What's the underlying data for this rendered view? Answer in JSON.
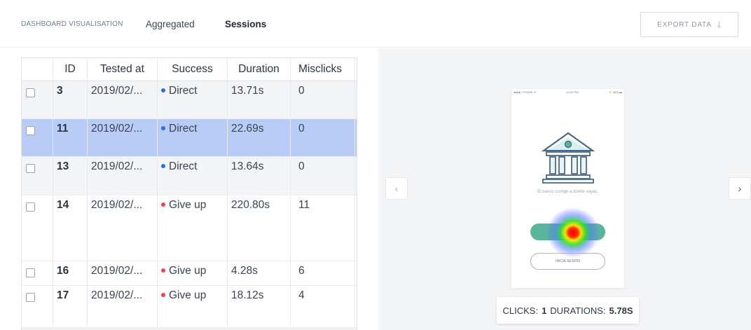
{
  "header": {
    "breadcrumb": "DASHBOARD VISUALISATION",
    "tabs": [
      {
        "label": "Aggregated"
      },
      {
        "label": "Sessions"
      }
    ],
    "export_label": "EXPORT DATA",
    "export_icon": "download-icon"
  },
  "table": {
    "columns": [
      "ID",
      "Tested at",
      "Success",
      "Duration",
      "Misclicks"
    ],
    "rows": [
      {
        "id": "3",
        "tested_at": "2019/02/...",
        "success": "Direct",
        "success_color": "#2d6de6",
        "duration": "13.71s",
        "misclicks": "0"
      },
      {
        "id": "11",
        "tested_at": "2019/02/...",
        "success": "Direct",
        "success_color": "#2d6de6",
        "duration": "22.69s",
        "misclicks": "0",
        "selected": true
      },
      {
        "id": "13",
        "tested_at": "2019/02/...",
        "success": "Direct",
        "success_color": "#2d6de6",
        "duration": "13.64s",
        "misclicks": "0"
      },
      {
        "id": "14",
        "tested_at": "2019/02/...",
        "success": "Give up",
        "success_color": "#ec4457",
        "duration": "220.80s",
        "misclicks": "11"
      },
      {
        "id": "16",
        "tested_at": "2019/02/...",
        "success": "Give up",
        "success_color": "#ec4457",
        "duration": "4.28s",
        "misclicks": "6"
      },
      {
        "id": "17",
        "tested_at": "2019/02/...",
        "success": "Give up",
        "success_color": "#ec4457",
        "duration": "18.12s",
        "misclicks": "4"
      }
    ]
  },
  "preview": {
    "status_left": "●●●●○ PHONE ᯤ",
    "status_time": "13:25 PM",
    "status_right": "⚡ 58% ▬",
    "tagline": "El banco contigo a donde vayas.",
    "login_button": "INICIA SESIÓN",
    "stats": {
      "clicks_label": "CLICKS:",
      "clicks_value": "1",
      "duration_label": "DURATIONS:",
      "duration_value": "5.78S"
    },
    "prev_icon": "chevron-left-icon",
    "next_icon": "chevron-right-icon"
  },
  "colors": {
    "selected_row": "#b8ccf7",
    "direct": "#2d6de6",
    "give_up": "#ec4457",
    "primary_button": "#5ab59e"
  }
}
